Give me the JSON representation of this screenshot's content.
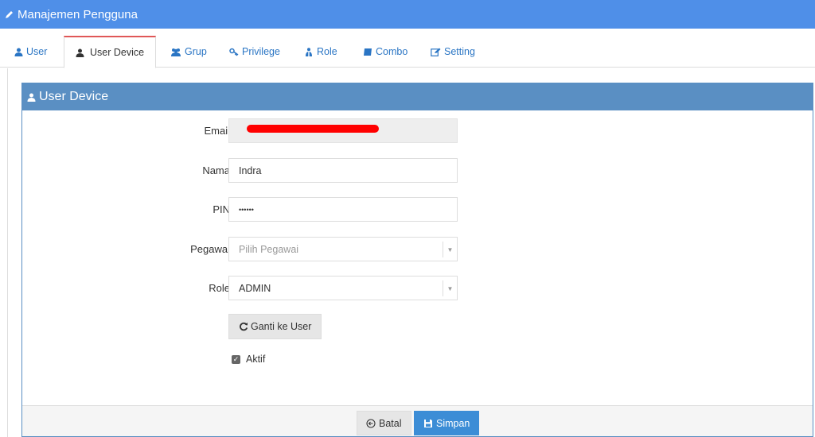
{
  "header": {
    "title": "Manajemen Pengguna"
  },
  "tabs": [
    {
      "label": "User",
      "icon": "user-icon"
    },
    {
      "label": "User Device",
      "icon": "user-icon"
    },
    {
      "label": "Grup",
      "icon": "users-icon"
    },
    {
      "label": "Privilege",
      "icon": "key-icon"
    },
    {
      "label": "Role",
      "icon": "sitemap-icon"
    },
    {
      "label": "Combo",
      "icon": "book-icon"
    },
    {
      "label": "Setting",
      "icon": "edit-icon"
    }
  ],
  "active_tab": "User Device",
  "panel": {
    "title": "User Device"
  },
  "form": {
    "email_label": "Email",
    "nama_label": "Nama",
    "nama_value": "Indra",
    "pin_label": "PIN",
    "pin_value": "••••••",
    "pegawai_label": "Pegawai",
    "pegawai_placeholder": "Pilih Pegawai",
    "role_label": "Role",
    "role_value": "ADMIN",
    "ganti_button": "Ganti ke User",
    "aktif_label": "Aktif",
    "aktif_checked": true
  },
  "footer": {
    "batal_label": "Batal",
    "simpan_label": "Simpan"
  },
  "colors": {
    "topbar": "#4f8fe8",
    "panel_head": "#5a8fc3",
    "primary": "#3c8dd6",
    "active_tab_border": "#e05757"
  }
}
